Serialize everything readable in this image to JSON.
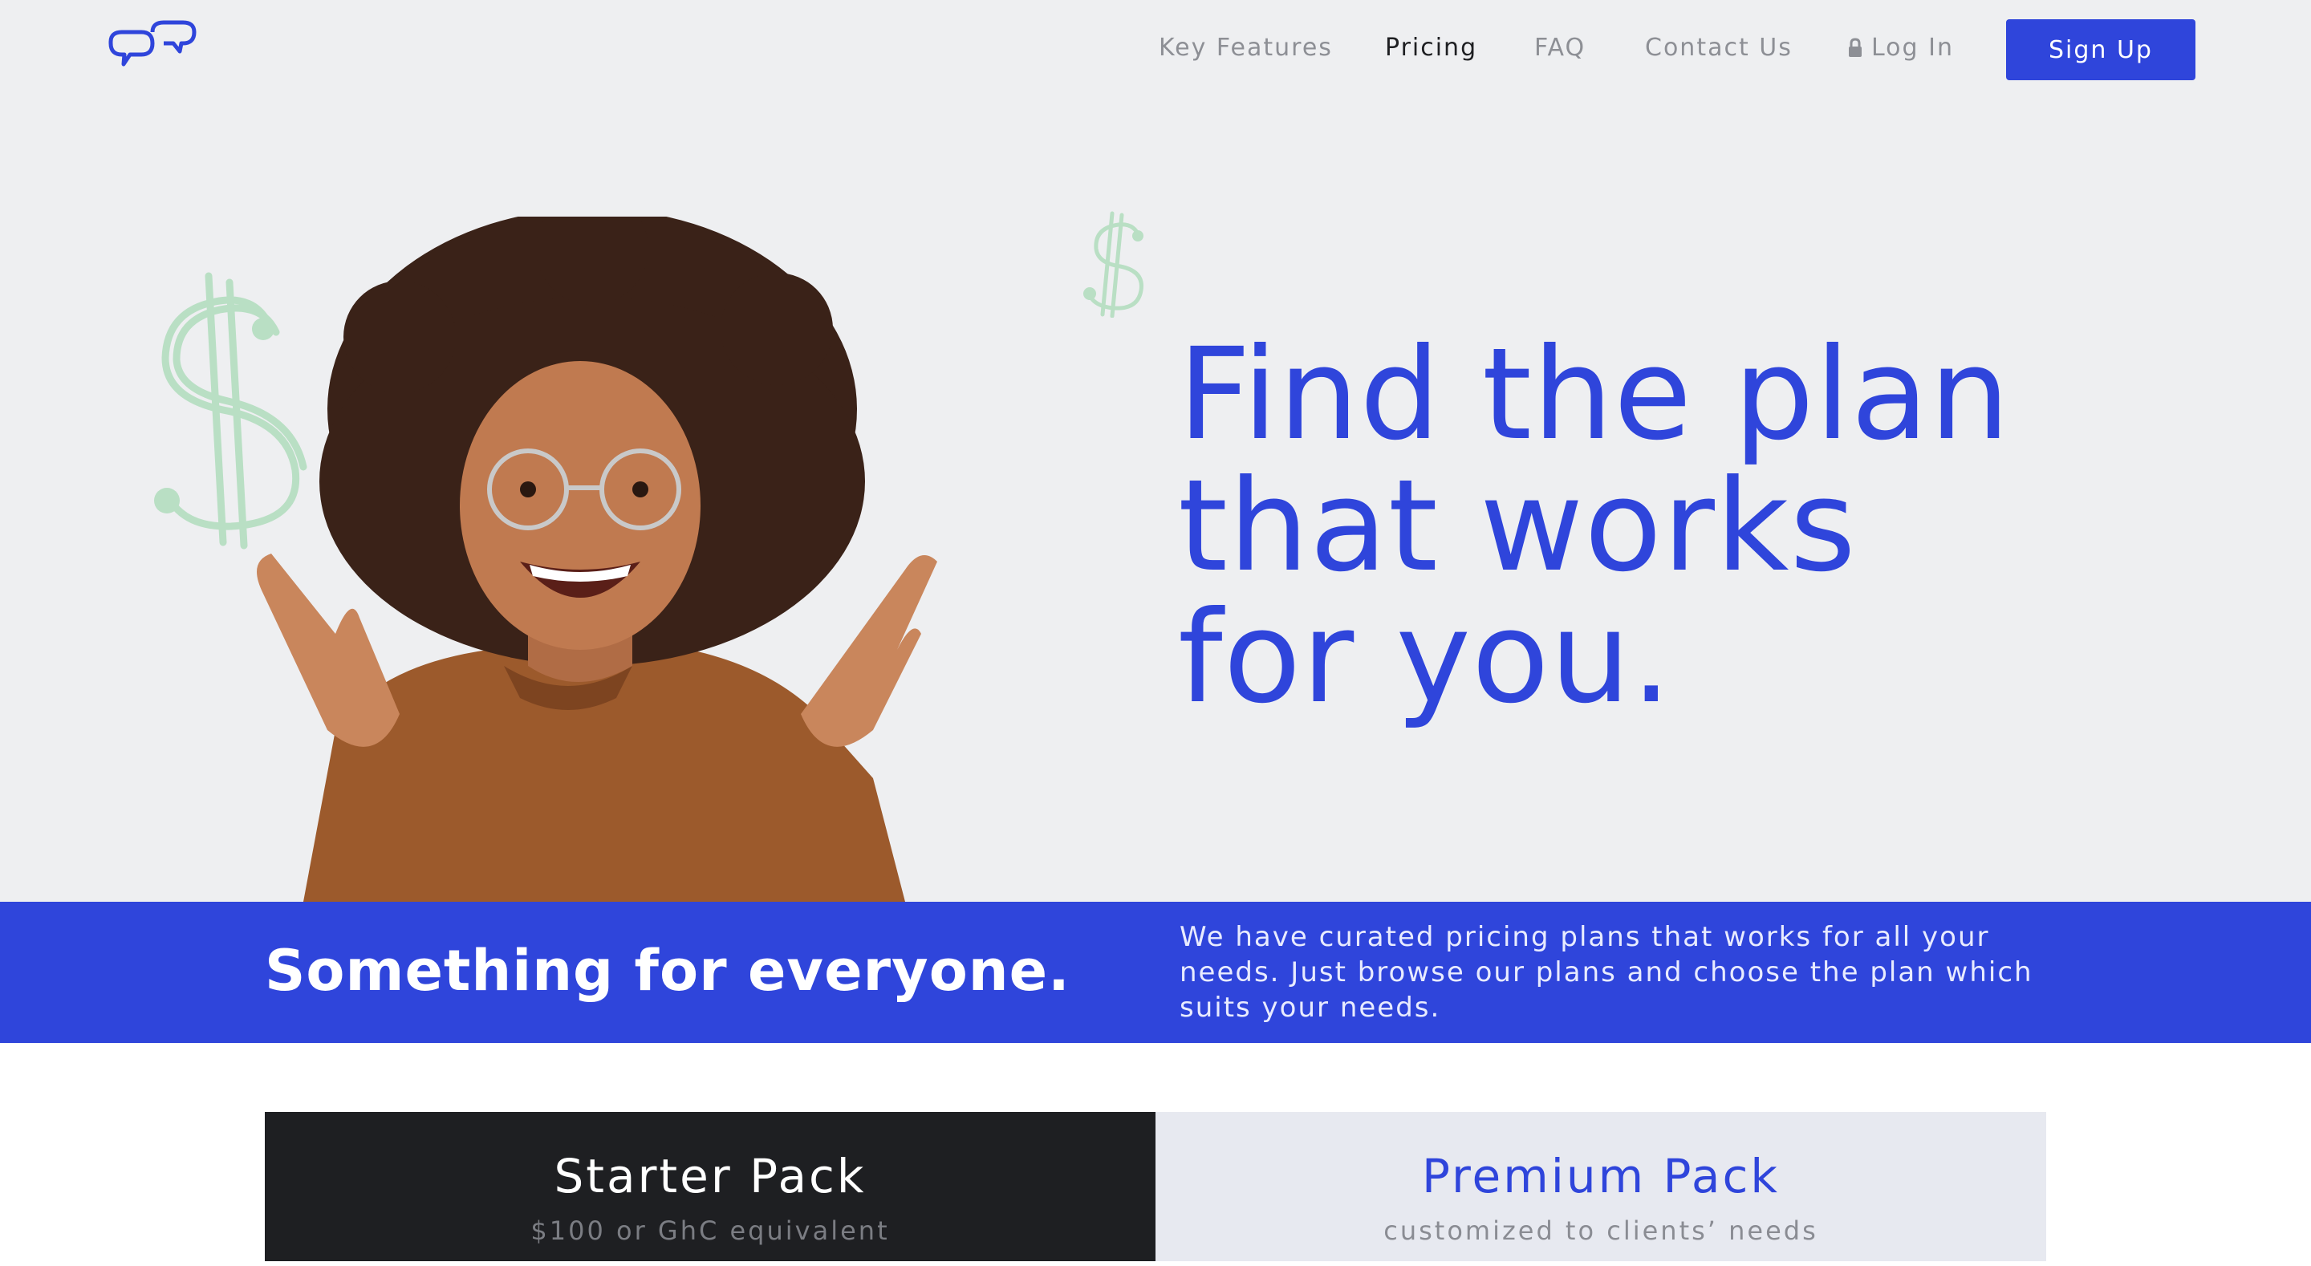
{
  "nav": {
    "links": [
      {
        "label": "Key Features",
        "active": false
      },
      {
        "label": "Pricing",
        "active": true
      },
      {
        "label": "FAQ",
        "active": false
      },
      {
        "label": "Contact Us",
        "active": false
      }
    ],
    "login_label": "Log In",
    "signup_label": "Sign Up"
  },
  "hero": {
    "headline": [
      "Find the plan",
      "that works",
      "for you."
    ]
  },
  "band": {
    "title": "Something for everyone.",
    "text": "We have curated pricing plans that works for all your needs. Just browse our plans and choose the plan which suits your needs."
  },
  "plans": [
    {
      "name": "Starter Pack",
      "subtitle": "$100 or GhC equivalent"
    },
    {
      "name": "Premium Pack",
      "subtitle": "customized to clients’ needs"
    }
  ],
  "icons": {
    "logo": "chat-bubbles-icon",
    "login": "lock-icon",
    "decor": "dollar-sign-icon"
  },
  "colors": {
    "brand": "#2f45db",
    "hero_bg": "#eeeff1",
    "dollar_decor": "#b9dfc4",
    "starter_bg": "#1e1f22",
    "premium_bg": "#e7e9f0"
  }
}
